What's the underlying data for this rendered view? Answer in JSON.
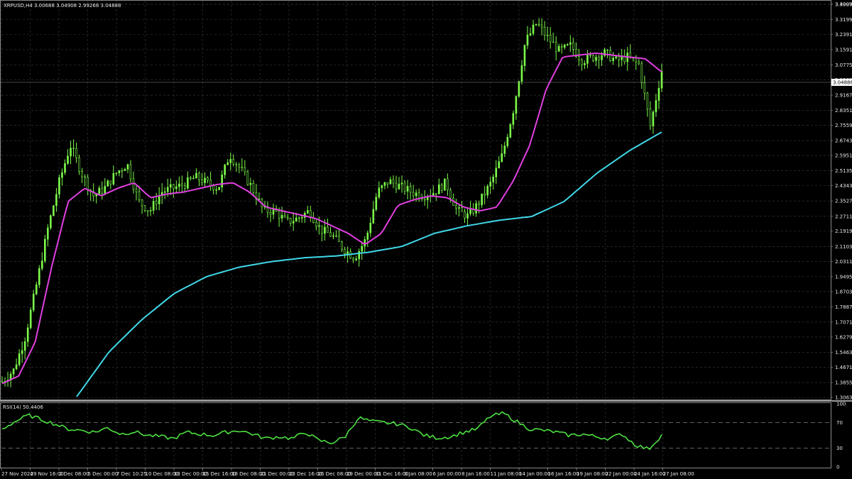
{
  "window": {
    "symbol_header": "XRPUSD,H4  3.00688 3.04908 2.99268 3.04888",
    "price_tag": "3.04888"
  },
  "price_axis": {
    "labels": [
      "3.40070",
      "3.39990",
      "3.31990",
      "3.23910",
      "3.15910",
      "3.07750",
      "2.99830",
      "2.91670",
      "2.83510",
      "2.75590",
      "2.67430",
      "2.59510",
      "2.51350",
      "2.43430",
      "2.35270",
      "2.27110",
      "2.19190",
      "2.11030",
      "2.03110",
      "1.94950",
      "1.87030",
      "1.78870",
      "1.70710",
      "1.62790",
      "1.54630",
      "1.46710",
      "1.38550",
      "1.30630"
    ],
    "values": [
      3.4007,
      3.3999,
      3.3199,
      3.2391,
      3.1591,
      3.0775,
      2.9983,
      2.9167,
      2.8351,
      2.7559,
      2.6743,
      2.5951,
      2.5135,
      2.4343,
      2.3527,
      2.2711,
      2.1919,
      2.1103,
      2.0311,
      1.9495,
      1.8703,
      1.7887,
      1.7071,
      1.6279,
      1.5463,
      1.4671,
      1.3855,
      1.3063
    ]
  },
  "time_axis": {
    "labels": [
      "27 Nov 2024",
      "29 Nov 16:00",
      "2 Dec 08:00",
      "5 Dec 00:00",
      "7 Dec 10:25",
      "10 Dec 08:00",
      "13 Dec 00:00",
      "15 Dec 16:00",
      "18 Dec 08:00",
      "21 Dec 00:00",
      "23 Dec 16:00",
      "26 Dec 08:00",
      "29 Dec 00:00",
      "31 Dec 16:00",
      "3 Jan 08:00",
      "6 Jan 00:00",
      "8 Jan 16:00",
      "11 Jan 08:00",
      "14 Jan 00:00",
      "16 Jan 16:00",
      "19 Jan 08:00",
      "22 Jan 00:00",
      "24 Jan 16:00",
      "27 Jan 08:00"
    ]
  },
  "rsi": {
    "header": "RSI(14) 50.4406",
    "axis_labels": [
      "100",
      "70",
      "30",
      "0"
    ],
    "levels": [
      100,
      70,
      30,
      0
    ]
  },
  "colors": {
    "background": "#000000",
    "candles": "#7CFC4A",
    "ma_fast": "#E040E0",
    "ma_slow": "#40D8E8",
    "rsi_line": "#4CE040",
    "grid": "#3a3a3a",
    "text": "#e8e8e8"
  },
  "chart_data": {
    "type": "line",
    "xlabel": "",
    "ylabel": "",
    "ylim": [
      1.3063,
      3.4007
    ],
    "grid": true,
    "series": [
      {
        "values": [
          1.39,
          1.45,
          1.62,
          1.9,
          2.2,
          2.45,
          2.65,
          2.5,
          2.38,
          2.42,
          2.5,
          2.55,
          2.35,
          2.3,
          2.4,
          2.42,
          2.44,
          2.48,
          2.45,
          2.42,
          2.6,
          2.52,
          2.42,
          2.3,
          2.3,
          2.24,
          2.26,
          2.3,
          2.2,
          2.17,
          2.1,
          2.05,
          2.15,
          2.4,
          2.46,
          2.43,
          2.4,
          2.38,
          2.4,
          2.45,
          2.3,
          2.27,
          2.35,
          2.45,
          2.6,
          2.85,
          3.2,
          3.3,
          3.22,
          3.15,
          3.18,
          3.1,
          3.12,
          3.14,
          3.1,
          3.12,
          3.08,
          2.75,
          3.04888
        ]
      },
      {
        "values": [
          1.38,
          1.42,
          1.6,
          2.0,
          2.35,
          2.42,
          2.38,
          2.42,
          2.45,
          2.37,
          2.39,
          2.4,
          2.42,
          2.44,
          2.45,
          2.4,
          2.32,
          2.3,
          2.28,
          2.26,
          2.22,
          2.18,
          2.12,
          2.18,
          2.33,
          2.36,
          2.38,
          2.37,
          2.32,
          2.3,
          2.32,
          2.46,
          2.65,
          2.95,
          3.12,
          3.13,
          3.14,
          3.13,
          3.12,
          3.11,
          3.04
        ]
      },
      {
        "values": [
          1.31,
          1.55,
          1.72,
          1.86,
          1.95,
          2.0,
          2.03,
          2.05,
          2.06,
          2.08,
          2.11,
          2.18,
          2.22,
          2.25,
          2.27,
          2.35,
          2.5,
          2.62,
          2.72
        ]
      },
      {
        "name": "RSI(14)",
        "values": [
          60,
          72,
          82,
          75,
          68,
          60,
          58,
          55,
          62,
          52,
          56,
          50,
          48,
          45,
          55,
          52,
          50,
          55,
          58,
          52,
          45,
          48,
          45,
          55,
          42,
          38,
          48,
          78,
          72,
          70,
          68,
          62,
          50,
          46,
          48,
          55,
          60,
          80,
          85,
          72,
          60,
          58,
          55,
          50,
          52,
          48,
          45,
          52,
          35,
          28,
          50.4406
        ]
      }
    ]
  }
}
